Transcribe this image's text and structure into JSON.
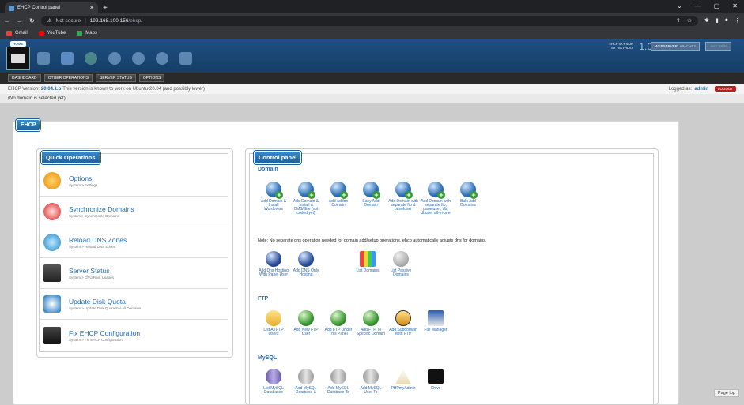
{
  "browser": {
    "tab_title": "EHCP Control panel",
    "not_secure": "Not secure",
    "url_host": "192.168.100.156",
    "url_path": "/ehcp/",
    "bookmarks": [
      "Gmail",
      "YouTube",
      "Maps"
    ]
  },
  "header": {
    "home_label": "HOME",
    "brand_line1": "EHCP SKY SKIN",
    "brand_line2": "BY 7SKYHOST",
    "version": "1.0",
    "webserver_label": "WEBSERVER:",
    "webserver_value": "APACHE2",
    "skin_label": "SKY SKIN"
  },
  "menu": [
    "DASHBOARD",
    "OTHER OPERATIONS",
    "SERVER STATUS",
    "OPTIONS"
  ],
  "info": {
    "prefix": "EHCP Version:",
    "version": "20.04.1.b",
    "note": "This version is known to work on Ubuntu-20.04 (and possibly lower)",
    "logged_as": "Logged as:",
    "user": "admin",
    "logout": "LOGOUT"
  },
  "no_domain": "(No domain is selected yet)",
  "ehcp_tag": "EHCP",
  "quick_ops": {
    "title": "Quick Operations",
    "items": [
      {
        "title": "Options",
        "sub": "System > Settings"
      },
      {
        "title": "Synchronize Domains",
        "sub": "System > Synchronize Domains"
      },
      {
        "title": "Reload DNS Zones",
        "sub": "System > Reload DNS Zones"
      },
      {
        "title": "Server Status",
        "sub": "System > CPU/Ram Usages"
      },
      {
        "title": "Update Disk Quota",
        "sub": "System > Update Disk Quota For All Domains"
      },
      {
        "title": "Fix EHCP Configuration",
        "sub": "System > Fix EHCP Configuration"
      }
    ]
  },
  "control_panel": {
    "title": "Control panel",
    "domain_title": "Domain",
    "domain_items": [
      "Add Domain & Install Wordpress",
      "Add Domain & Install a CMS/Site (not coded yet)",
      "Add Addon Domain",
      "Easy Add Domain",
      "Add Domain with separate ftp & paneluser",
      "Add Domain with separate ftp, paneluser, db, dbuser all-in-one",
      "Bulk Add Domains"
    ],
    "note": "Note: No separate dns operation needed for domain add/setup operations. ehcp automatically adjusts dns for domains.",
    "dns_items": [
      "Add Dns Hosting With Panel User",
      "Add DNS Only Hosting",
      "List Domains",
      "List Passive Domains"
    ],
    "ftp_title": "FTP",
    "ftp_items": [
      "List All FTP Users",
      "Add New FTP User",
      "Add FTP Under This Panel",
      "Add FTP To Specific Domain",
      "Add Subdomain With FTP",
      "File Manager"
    ],
    "mysql_title": "MySQL",
    "mysql_items": [
      "List MySQL Databases",
      "Add MySQL Database &",
      "Add MySQL Database To",
      "Add MySQL User To",
      "PHPmyAdmin",
      "Chive"
    ]
  },
  "page_top": "Page top"
}
